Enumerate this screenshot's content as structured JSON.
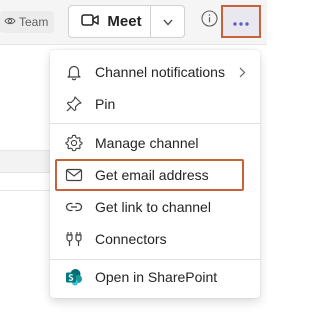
{
  "header": {
    "team_label": "Team",
    "meet_label": "Meet"
  },
  "menu": {
    "items": [
      {
        "label": "Channel notifications",
        "icon": "bell-icon",
        "has_submenu": true
      },
      {
        "label": "Pin",
        "icon": "pin-icon",
        "has_submenu": false
      },
      {
        "label": "Manage channel",
        "icon": "gear-icon",
        "has_submenu": false
      },
      {
        "label": "Get email address",
        "icon": "mail-icon",
        "has_submenu": false
      },
      {
        "label": "Get link to channel",
        "icon": "link-icon",
        "has_submenu": false
      },
      {
        "label": "Connectors",
        "icon": "plug-icon",
        "has_submenu": false
      },
      {
        "label": "Open in SharePoint",
        "icon": "sharepoint-icon",
        "has_submenu": false
      }
    ]
  },
  "colors": {
    "highlight_border": "#c8623a",
    "more_icon": "#5b5fc7",
    "sharepoint_teal": "#036c70"
  }
}
